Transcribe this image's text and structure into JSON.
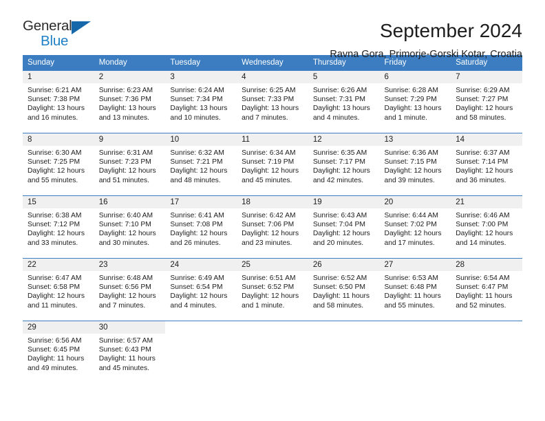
{
  "brand": {
    "name_part1": "General",
    "name_part2": "Blue",
    "triangle_color": "#1668ab",
    "blue_color": "#1d7fc4"
  },
  "header": {
    "title": "September 2024",
    "subtitle": "Ravna Gora, Primorje-Gorski Kotar, Croatia",
    "header_bg_color": "#3b7dc0",
    "daynum_bg_color": "#f0f0f0"
  },
  "weekday_headers": [
    "Sunday",
    "Monday",
    "Tuesday",
    "Wednesday",
    "Thursday",
    "Friday",
    "Saturday"
  ],
  "weeks": [
    [
      {
        "day": "1",
        "sunrise": "Sunrise: 6:21 AM",
        "sunset": "Sunset: 7:38 PM",
        "daylight": "Daylight: 13 hours and 16 minutes."
      },
      {
        "day": "2",
        "sunrise": "Sunrise: 6:23 AM",
        "sunset": "Sunset: 7:36 PM",
        "daylight": "Daylight: 13 hours and 13 minutes."
      },
      {
        "day": "3",
        "sunrise": "Sunrise: 6:24 AM",
        "sunset": "Sunset: 7:34 PM",
        "daylight": "Daylight: 13 hours and 10 minutes."
      },
      {
        "day": "4",
        "sunrise": "Sunrise: 6:25 AM",
        "sunset": "Sunset: 7:33 PM",
        "daylight": "Daylight: 13 hours and 7 minutes."
      },
      {
        "day": "5",
        "sunrise": "Sunrise: 6:26 AM",
        "sunset": "Sunset: 7:31 PM",
        "daylight": "Daylight: 13 hours and 4 minutes."
      },
      {
        "day": "6",
        "sunrise": "Sunrise: 6:28 AM",
        "sunset": "Sunset: 7:29 PM",
        "daylight": "Daylight: 13 hours and 1 minute."
      },
      {
        "day": "7",
        "sunrise": "Sunrise: 6:29 AM",
        "sunset": "Sunset: 7:27 PM",
        "daylight": "Daylight: 12 hours and 58 minutes."
      }
    ],
    [
      {
        "day": "8",
        "sunrise": "Sunrise: 6:30 AM",
        "sunset": "Sunset: 7:25 PM",
        "daylight": "Daylight: 12 hours and 55 minutes."
      },
      {
        "day": "9",
        "sunrise": "Sunrise: 6:31 AM",
        "sunset": "Sunset: 7:23 PM",
        "daylight": "Daylight: 12 hours and 51 minutes."
      },
      {
        "day": "10",
        "sunrise": "Sunrise: 6:32 AM",
        "sunset": "Sunset: 7:21 PM",
        "daylight": "Daylight: 12 hours and 48 minutes."
      },
      {
        "day": "11",
        "sunrise": "Sunrise: 6:34 AM",
        "sunset": "Sunset: 7:19 PM",
        "daylight": "Daylight: 12 hours and 45 minutes."
      },
      {
        "day": "12",
        "sunrise": "Sunrise: 6:35 AM",
        "sunset": "Sunset: 7:17 PM",
        "daylight": "Daylight: 12 hours and 42 minutes."
      },
      {
        "day": "13",
        "sunrise": "Sunrise: 6:36 AM",
        "sunset": "Sunset: 7:15 PM",
        "daylight": "Daylight: 12 hours and 39 minutes."
      },
      {
        "day": "14",
        "sunrise": "Sunrise: 6:37 AM",
        "sunset": "Sunset: 7:14 PM",
        "daylight": "Daylight: 12 hours and 36 minutes."
      }
    ],
    [
      {
        "day": "15",
        "sunrise": "Sunrise: 6:38 AM",
        "sunset": "Sunset: 7:12 PM",
        "daylight": "Daylight: 12 hours and 33 minutes."
      },
      {
        "day": "16",
        "sunrise": "Sunrise: 6:40 AM",
        "sunset": "Sunset: 7:10 PM",
        "daylight": "Daylight: 12 hours and 30 minutes."
      },
      {
        "day": "17",
        "sunrise": "Sunrise: 6:41 AM",
        "sunset": "Sunset: 7:08 PM",
        "daylight": "Daylight: 12 hours and 26 minutes."
      },
      {
        "day": "18",
        "sunrise": "Sunrise: 6:42 AM",
        "sunset": "Sunset: 7:06 PM",
        "daylight": "Daylight: 12 hours and 23 minutes."
      },
      {
        "day": "19",
        "sunrise": "Sunrise: 6:43 AM",
        "sunset": "Sunset: 7:04 PM",
        "daylight": "Daylight: 12 hours and 20 minutes."
      },
      {
        "day": "20",
        "sunrise": "Sunrise: 6:44 AM",
        "sunset": "Sunset: 7:02 PM",
        "daylight": "Daylight: 12 hours and 17 minutes."
      },
      {
        "day": "21",
        "sunrise": "Sunrise: 6:46 AM",
        "sunset": "Sunset: 7:00 PM",
        "daylight": "Daylight: 12 hours and 14 minutes."
      }
    ],
    [
      {
        "day": "22",
        "sunrise": "Sunrise: 6:47 AM",
        "sunset": "Sunset: 6:58 PM",
        "daylight": "Daylight: 12 hours and 11 minutes."
      },
      {
        "day": "23",
        "sunrise": "Sunrise: 6:48 AM",
        "sunset": "Sunset: 6:56 PM",
        "daylight": "Daylight: 12 hours and 7 minutes."
      },
      {
        "day": "24",
        "sunrise": "Sunrise: 6:49 AM",
        "sunset": "Sunset: 6:54 PM",
        "daylight": "Daylight: 12 hours and 4 minutes."
      },
      {
        "day": "25",
        "sunrise": "Sunrise: 6:51 AM",
        "sunset": "Sunset: 6:52 PM",
        "daylight": "Daylight: 12 hours and 1 minute."
      },
      {
        "day": "26",
        "sunrise": "Sunrise: 6:52 AM",
        "sunset": "Sunset: 6:50 PM",
        "daylight": "Daylight: 11 hours and 58 minutes."
      },
      {
        "day": "27",
        "sunrise": "Sunrise: 6:53 AM",
        "sunset": "Sunset: 6:48 PM",
        "daylight": "Daylight: 11 hours and 55 minutes."
      },
      {
        "day": "28",
        "sunrise": "Sunrise: 6:54 AM",
        "sunset": "Sunset: 6:47 PM",
        "daylight": "Daylight: 11 hours and 52 minutes."
      }
    ],
    [
      {
        "day": "29",
        "sunrise": "Sunrise: 6:56 AM",
        "sunset": "Sunset: 6:45 PM",
        "daylight": "Daylight: 11 hours and 49 minutes."
      },
      {
        "day": "30",
        "sunrise": "Sunrise: 6:57 AM",
        "sunset": "Sunset: 6:43 PM",
        "daylight": "Daylight: 11 hours and 45 minutes."
      },
      {
        "day": "",
        "sunrise": "",
        "sunset": "",
        "daylight": ""
      },
      {
        "day": "",
        "sunrise": "",
        "sunset": "",
        "daylight": ""
      },
      {
        "day": "",
        "sunrise": "",
        "sunset": "",
        "daylight": ""
      },
      {
        "day": "",
        "sunrise": "",
        "sunset": "",
        "daylight": ""
      },
      {
        "day": "",
        "sunrise": "",
        "sunset": "",
        "daylight": ""
      }
    ]
  ]
}
